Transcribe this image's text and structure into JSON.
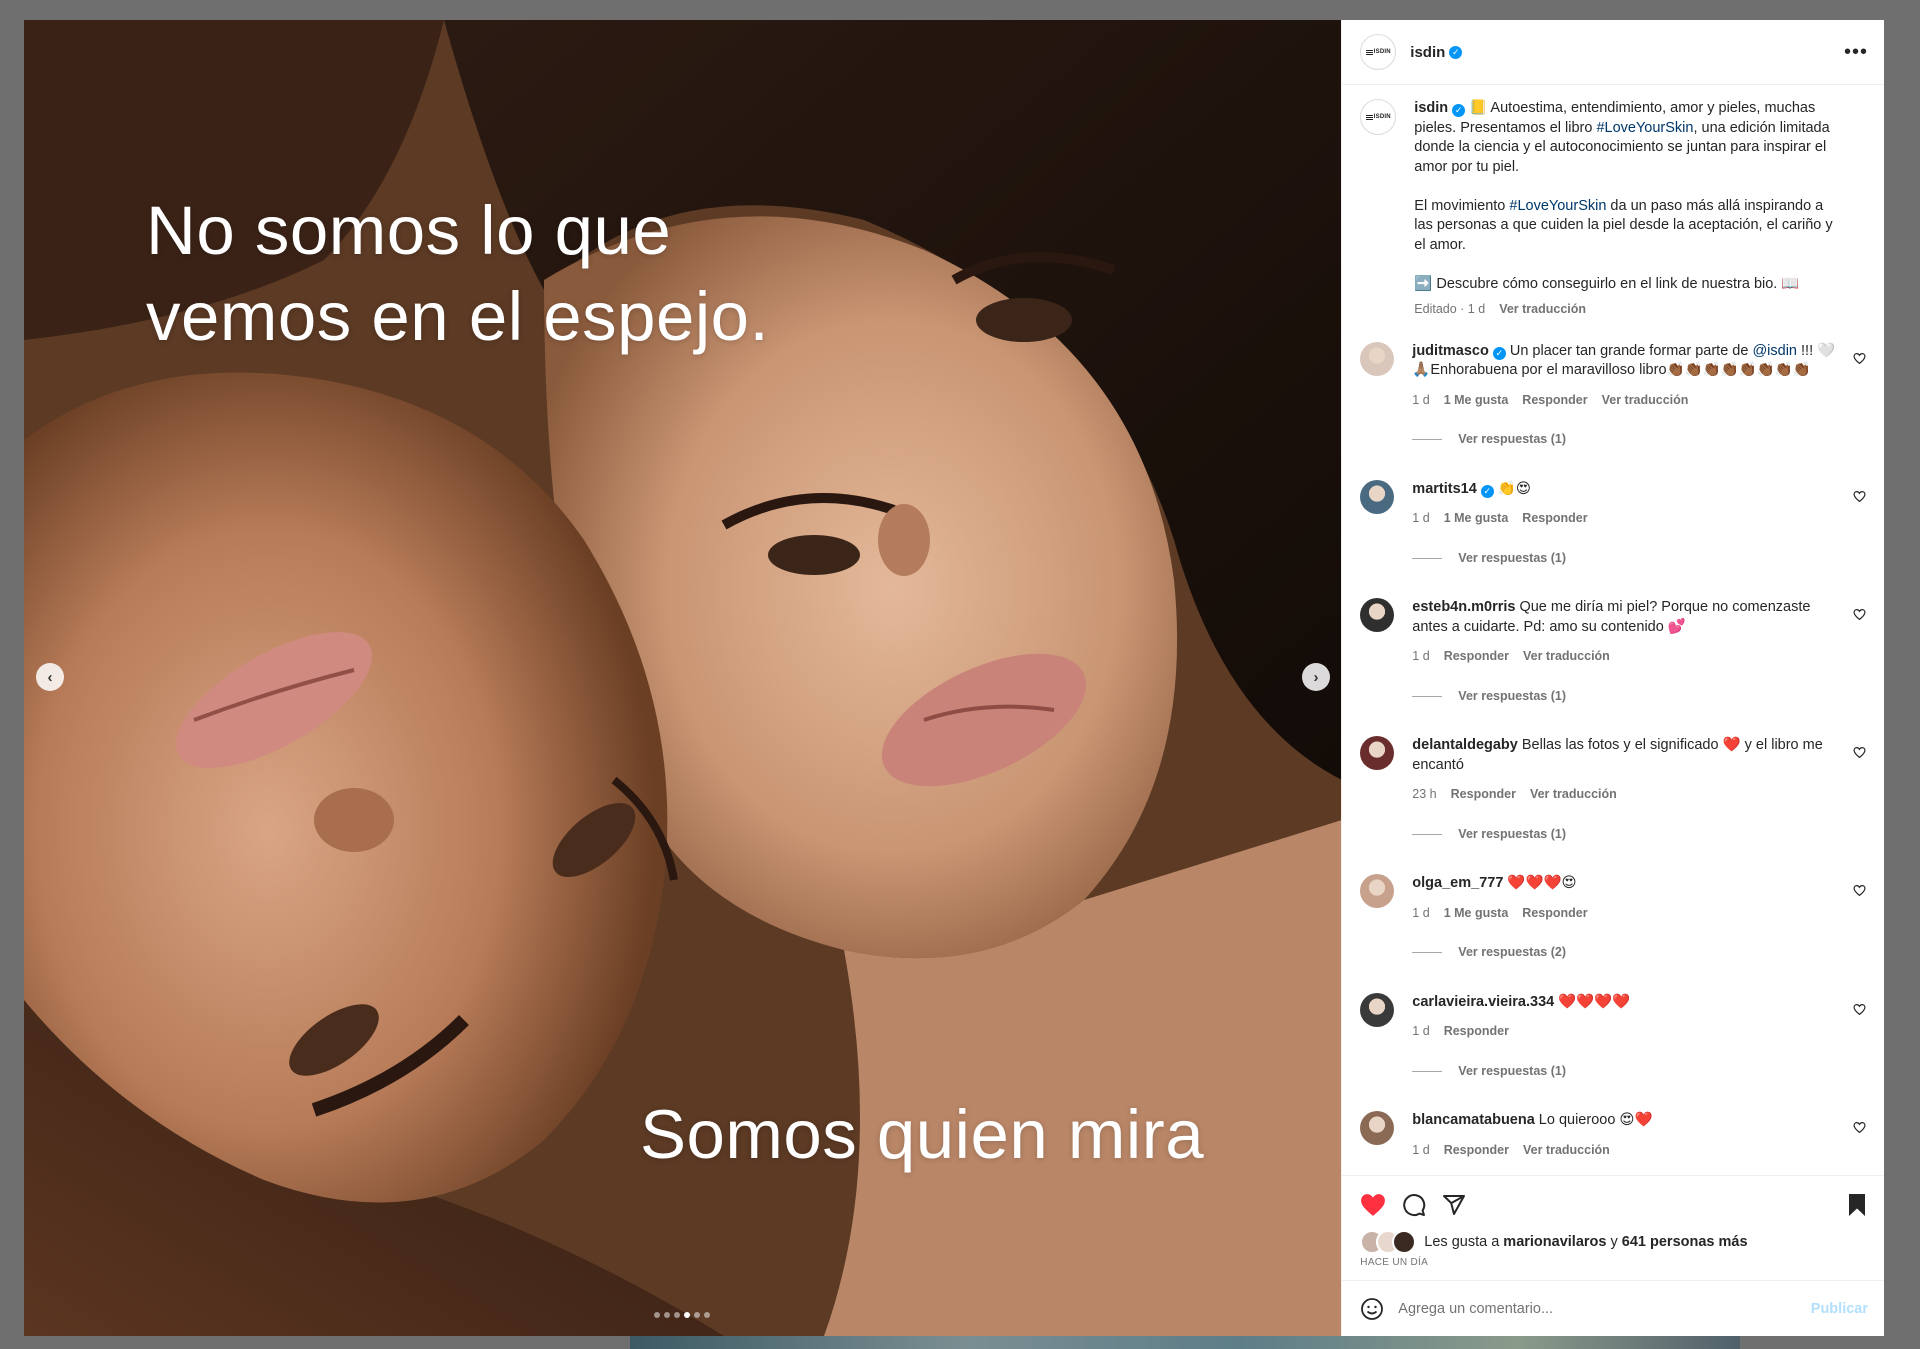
{
  "media": {
    "caption_top_line1": "No somos lo que",
    "caption_top_line2": "vemos en el espejo.",
    "caption_bottom": "Somos quien mira",
    "prev_icon": "‹",
    "next_icon": "›",
    "slide_count": 6,
    "active_slide": 4
  },
  "header": {
    "logo_text": "ISDIN",
    "username": "isdin",
    "verified_icon": "✓",
    "more_icon": "•••"
  },
  "caption": {
    "username": "isdin",
    "p1_a": "📒 Autoestima, entendimiento, amor y pieles, muchas pieles. Presentamos el libro ",
    "p1_tag": "#LoveYourSkin",
    "p1_b": ", una edición limitada donde la ciencia y el autoconocimiento se juntan para inspirar el amor por tu piel.",
    "p2_a": "El movimiento ",
    "p2_tag": "#LoveYourSkin",
    "p2_b": " da un paso más allá inspirando a las personas a que cuiden la piel desde la aceptación, el cariño y el amor.",
    "p3": "➡️ Descubre cómo conseguirlo en el link de nuestra bio. 📖",
    "edited": "Editado · 1 d",
    "translate": "Ver traducción"
  },
  "comments": [
    {
      "user": "juditmasco",
      "verified": true,
      "text_a": "Un placer tan grande formar parte de ",
      "mention": "@isdin",
      "text_b": " !!! 🤍🙏🏽Enhorabuena por el maravilloso libro👏🏾👏🏾👏🏾👏🏾👏🏾👏🏾👏🏾👏🏾",
      "time": "1 d",
      "likes": "1 Me gusta",
      "reply": "Responder",
      "translate": "Ver traducción",
      "replies": "Ver respuestas (1)"
    },
    {
      "user": "martits14",
      "verified": true,
      "text_a": "👏😍",
      "time": "1 d",
      "likes": "1 Me gusta",
      "reply": "Responder",
      "replies": "Ver respuestas (1)"
    },
    {
      "user": "esteb4n.m0rris",
      "verified": false,
      "text_a": "Que me diría mi piel? Porque no comenzaste antes a cuidarte. Pd: amo su contenido 💕",
      "time": "1 d",
      "reply": "Responder",
      "translate": "Ver traducción",
      "replies": "Ver respuestas (1)"
    },
    {
      "user": "delantaldegaby",
      "verified": false,
      "text_a": "Bellas las fotos y el significado ❤️ y el libro me encantó",
      "time": "23 h",
      "reply": "Responder",
      "translate": "Ver traducción",
      "replies": "Ver respuestas (1)"
    },
    {
      "user": "olga_em_777",
      "verified": false,
      "text_a": "❤️❤️❤️😍",
      "time": "1 d",
      "likes": "1 Me gusta",
      "reply": "Responder",
      "replies": "Ver respuestas (2)"
    },
    {
      "user": "carlavieira.vieira.334",
      "verified": false,
      "text_a": "❤️❤️❤️❤️",
      "time": "1 d",
      "reply": "Responder",
      "replies": "Ver respuestas (1)"
    },
    {
      "user": "blancamatabuena",
      "verified": false,
      "text_a": "Lo quierooo 😍❤️",
      "time": "1 d",
      "reply": "Responder",
      "translate": "Ver traducción",
      "replies": "Ver respuestas (1)"
    }
  ],
  "actions": {
    "like_icon": "heart-filled-icon",
    "comment_icon": "comment-icon",
    "share_icon": "share-icon",
    "save_icon": "bookmark-filled-icon",
    "likes_prefix": "Les gusta a ",
    "likes_user": "marionavilaros",
    "likes_mid": " y ",
    "likes_count": "641 personas más",
    "time": "HACE UN DÍA"
  },
  "add_comment": {
    "emoji_icon": "smiley-icon",
    "placeholder": "Agrega un comentario...",
    "publish": "Publicar"
  },
  "colors": {
    "heart": "#ff3040",
    "link": "#00376b",
    "verified": "#0095f6",
    "publish_disabled": "#b2dffc"
  }
}
